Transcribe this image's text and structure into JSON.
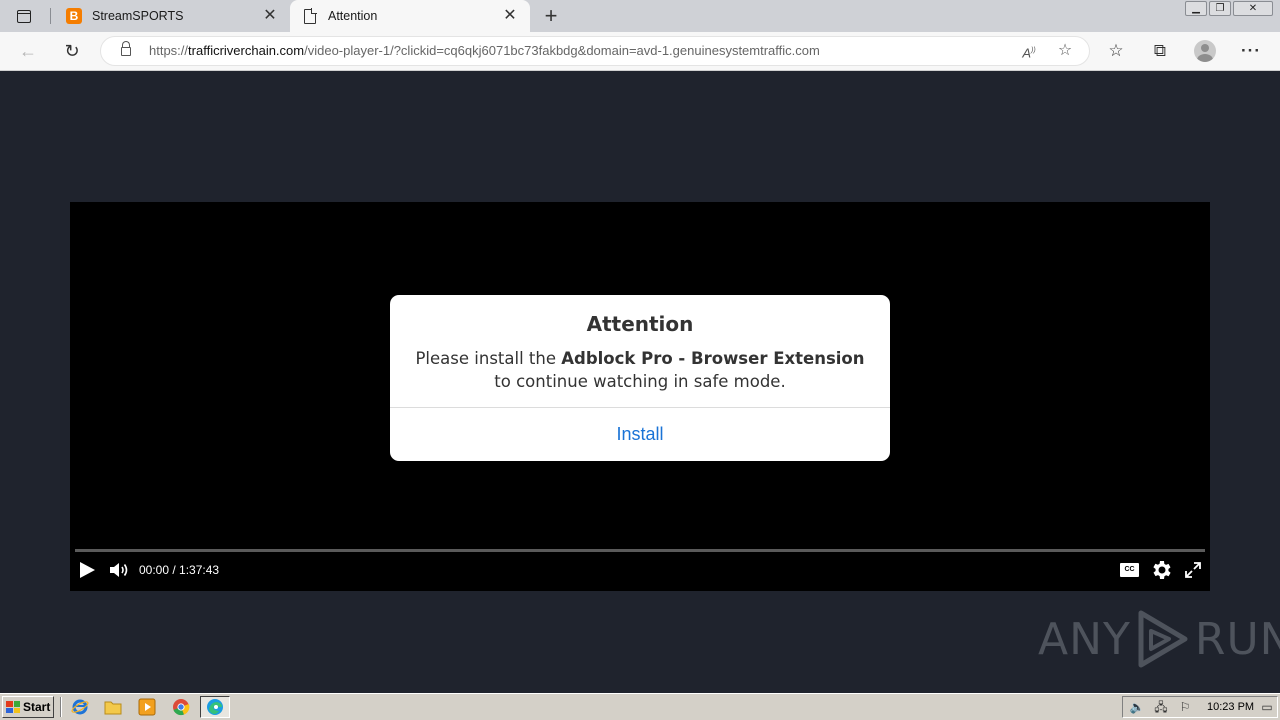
{
  "browser": {
    "tabs": [
      {
        "title": "StreamSPORTS",
        "favicon": "blogger-icon",
        "active": false
      },
      {
        "title": "Attention",
        "favicon": "page-icon",
        "active": true
      }
    ],
    "address": {
      "host": "trafficriverchain.com",
      "scheme": "https://",
      "path": "/video-player-1/?clickid=cq6qkj6071bc73fakbdg&domain=avd-1.genuinesystemtraffic.com"
    }
  },
  "player": {
    "time": "00:00 / 1:37:43",
    "cc_label": "CC"
  },
  "modal": {
    "title": "Attention",
    "text_before": "Please install the ",
    "text_bold": "Adblock Pro - Browser Extension",
    "text_after": "to continue watching in safe mode.",
    "button": "Install"
  },
  "watermark": {
    "left": "ANY",
    "right": "RUN"
  },
  "taskbar": {
    "start_label": "Start",
    "clock": "10:23 PM"
  },
  "colors": {
    "page_background": "#1f232d",
    "install_link": "#1a73d6",
    "blogger_orange": "#f57d00"
  }
}
